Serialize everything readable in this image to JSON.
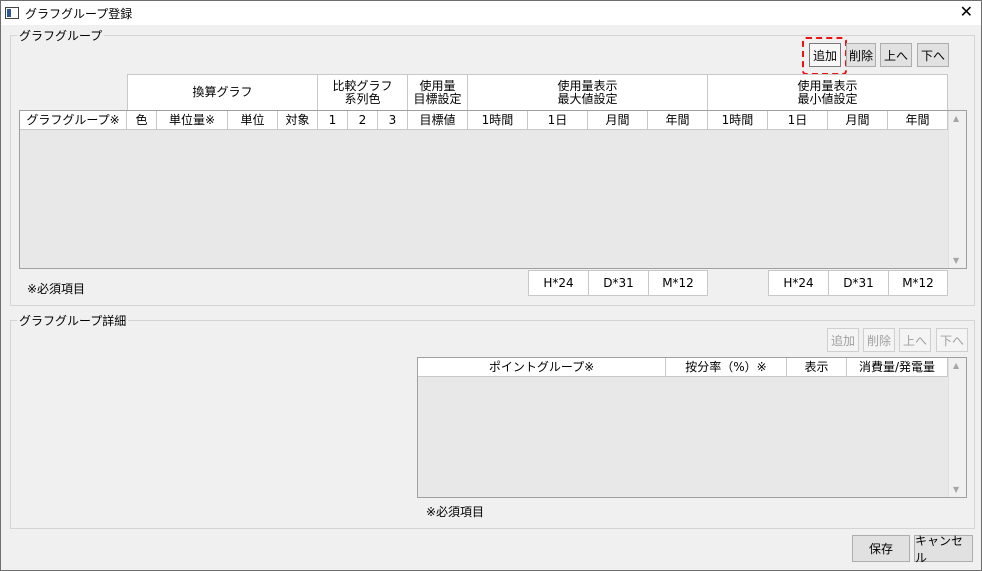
{
  "window": {
    "title": "グラフグループ登録"
  },
  "group1": {
    "legend": "グラフグループ",
    "buttons": {
      "add": "追加",
      "delete": "削除",
      "up": "上へ",
      "down": "下へ"
    },
    "headers_top": {
      "conversion_graph": "換算グラフ",
      "comparison_graph_l1": "比較グラフ",
      "comparison_graph_l2": "系列色",
      "usage_target_l1": "使用量",
      "usage_target_l2": "目標設定",
      "usage_max_l1": "使用量表示",
      "usage_max_l2": "最大値設定",
      "usage_min_l1": "使用量表示",
      "usage_min_l2": "最小値設定"
    },
    "columns": [
      "グラフグループ※",
      "色",
      "単位量※",
      "単位",
      "対象",
      "1",
      "2",
      "3",
      "目標値",
      "1時間",
      "1日",
      "月間",
      "年間",
      "1時間",
      "1日",
      "月間",
      "年間"
    ],
    "note": "※必須項目",
    "summary_max": [
      "H*24",
      "D*31",
      "M*12"
    ],
    "summary_min": [
      "H*24",
      "D*31",
      "M*12"
    ]
  },
  "group2": {
    "legend": "グラフグループ詳細",
    "buttons": {
      "add": "追加",
      "delete": "削除",
      "up": "上へ",
      "down": "下へ"
    },
    "columns": [
      "ポイントグループ※",
      "按分率（%）※",
      "表示",
      "消費量/発電量"
    ],
    "note": "※必須項目"
  },
  "footer": {
    "save": "保存",
    "cancel": "キャンセル"
  },
  "colors": {
    "highlight_box": "#ee1111",
    "grid_bg": "#e8e8e8"
  }
}
